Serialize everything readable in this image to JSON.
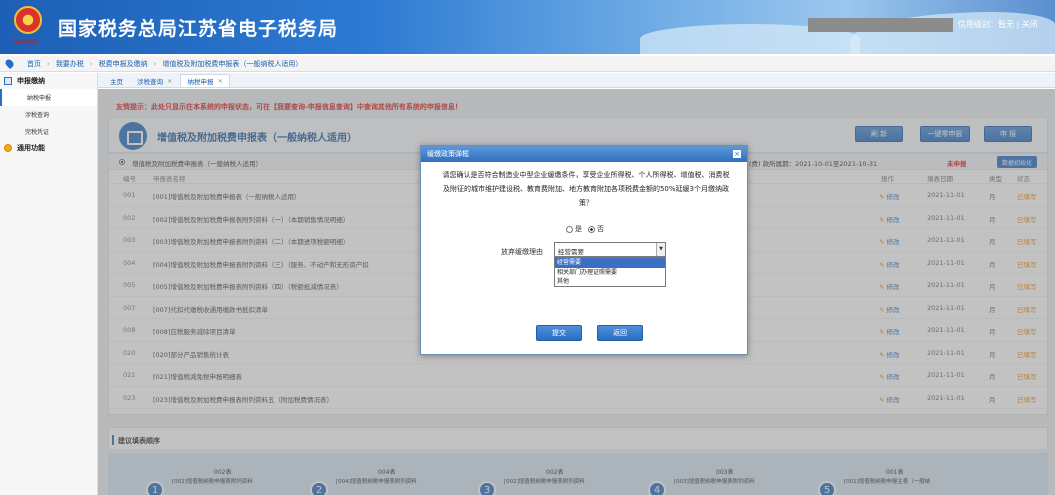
{
  "header": {
    "emblem_text": "中国税务",
    "site_title": "国家税务总局江苏省电子税务局",
    "credit_label": "信用级别：暂无 | 关闭"
  },
  "breadcrumb": {
    "items": [
      "首页",
      "我要办税",
      "税费申报及缴纳",
      "增值税及附加税费申报表（一般纳税人适用）"
    ]
  },
  "sidebar": {
    "groups": [
      {
        "label": "申报缴纳",
        "items": [
          "纳税申报",
          "涉税查询",
          "完税凭证"
        ]
      },
      {
        "label": "通用功能",
        "items": []
      }
    ]
  },
  "tabs": [
    {
      "label": "主页"
    },
    {
      "label": "涉税查询"
    },
    {
      "label": "纳税申报"
    }
  ],
  "main": {
    "tip": "友情提示：此处只显示在本系统的申报状态，可在【我要查询-申报信息查询】中查询其他所有系统的申报信息！",
    "form_title": "增值税及附加税费申报表（一般纳税人适用）",
    "buttons": {
      "refresh": "刷 新",
      "zero": "一键零申报",
      "declare": "申 报"
    },
    "status": {
      "form_name": "增值税及附加税费申报表（一般纳税人适用）",
      "period": "(费) 款所属期：2021-10-01至2021-10-31",
      "state": "未申报",
      "init_button": "数据初始化"
    },
    "table": {
      "headers": {
        "no": "编号",
        "name": "申报表名称",
        "op": "操作",
        "date": "填表日期",
        "type": "类型",
        "state": "状态"
      },
      "rows": [
        {
          "no": "001",
          "name": "[001]增值税及附加税费申报表（一般纳税人适用）",
          "op": "修改",
          "date": "2021-11-01",
          "type": "月",
          "state": "已填写"
        },
        {
          "no": "002",
          "name": "[002]增值税及附加税费申报表附列资料（一）（本期销售情况明细）",
          "op": "修改",
          "date": "2021-11-01",
          "type": "月",
          "state": "已填写"
        },
        {
          "no": "003",
          "name": "[003]增值税及附加税费申报表附列资料（二）（本期进项税额明细）",
          "op": "修改",
          "date": "2021-11-01",
          "type": "月",
          "state": "已填写"
        },
        {
          "no": "004",
          "name": "[004]增值税及附加税费申报表附列资料（三）（服务、不动产和无形资产扣",
          "op": "修改",
          "date": "2021-11-01",
          "type": "月",
          "state": "已填写"
        },
        {
          "no": "005",
          "name": "[005]增值税及附加税费申报表附列资料（四）（税额抵减情况表）",
          "op": "修改",
          "date": "2021-11-01",
          "type": "月",
          "state": "已填写"
        },
        {
          "no": "007",
          "name": "[007]代扣代缴税收通用缴款书抵扣清单",
          "op": "修改",
          "date": "2021-11-01",
          "type": "月",
          "state": "已填写"
        },
        {
          "no": "008",
          "name": "[008]应税服务减除项目清单",
          "op": "修改",
          "date": "2021-11-01",
          "type": "月",
          "state": "已填写"
        },
        {
          "no": "020",
          "name": "[020]部分产品销售统计表",
          "op": "修改",
          "date": "2021-11-01",
          "type": "月",
          "state": "已填写"
        },
        {
          "no": "021",
          "name": "[021]增值税减免税申报明细表",
          "op": "修改",
          "date": "2021-11-01",
          "type": "月",
          "state": "已填写"
        },
        {
          "no": "023",
          "name": "[023]增值税及附加税费申报表附列资料五（附加税费情况表）",
          "op": "修改",
          "date": "2021-11-01",
          "type": "月",
          "state": "已填写"
        }
      ]
    },
    "order": {
      "title": "建议填表顺序",
      "steps": [
        {
          "num": "1",
          "code": "002表",
          "desc": "[002]增值税纳税申报表附列资料"
        },
        {
          "num": "2",
          "code": "004表",
          "desc": "[004]增值税纳税申报表附列资料"
        },
        {
          "num": "3",
          "code": "002表",
          "desc": "[002]增值税纳税申报表附列资料"
        },
        {
          "num": "4",
          "code": "003表",
          "desc": "[003]增值税纳税申报表附列资料"
        },
        {
          "num": "5",
          "code": "001表",
          "desc": "[001]增值税纳税申报主表（一般纳"
        }
      ]
    }
  },
  "dialog": {
    "title": "缓缴政策弹框",
    "message": "请您确认是否符合制造业中型企业缓缴条件，享受企业所得税、个人所得税、增值税、消费税及附征的城市维护建设税、教育费附加、地方教育附加各项税费金额的50%延缓3个月缴纳政策？",
    "radio_yes": "是",
    "radio_no": "否",
    "reason_label": "放弃缓缴理由",
    "select_value": "经营需要",
    "options": [
      "经营需要",
      "相关部门办理证照需要",
      "其他"
    ],
    "submit": "提交",
    "back": "返回"
  }
}
